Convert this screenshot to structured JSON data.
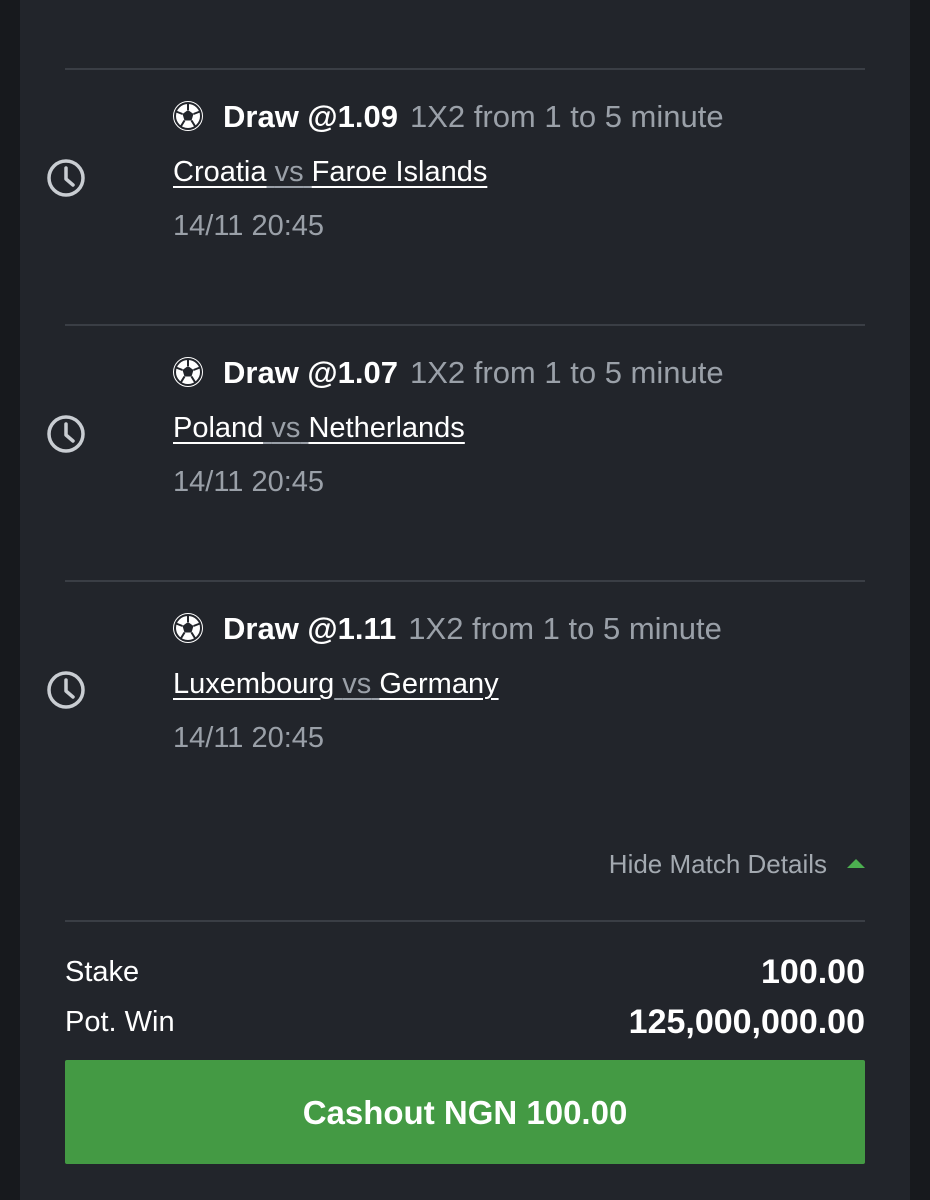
{
  "matches": [
    {
      "pick": "Draw @1.09",
      "market": "1X2 from 1 to 5 minute",
      "home": "Croatia",
      "vs": "vs",
      "away": "Faroe Islands",
      "datetime": "14/11 20:45",
      "icon": "soccer-ball-icon",
      "status_icon": "clock-icon"
    },
    {
      "pick": "Draw @1.07",
      "market": "1X2 from 1 to 5 minute",
      "home": "Poland",
      "vs": "vs",
      "away": "Netherlands",
      "datetime": "14/11 20:45",
      "icon": "soccer-ball-icon",
      "status_icon": "clock-icon"
    },
    {
      "pick": "Draw @1.11",
      "market": "1X2 from 1 to 5 minute",
      "home": "Luxembourg",
      "vs": "vs",
      "away": "Germany",
      "datetime": "14/11 20:45",
      "icon": "soccer-ball-icon",
      "status_icon": "clock-icon"
    }
  ],
  "details_toggle": {
    "label": "Hide Match Details",
    "icon": "caret-up-icon"
  },
  "summary": {
    "stake_label": "Stake",
    "stake_value": "100.00",
    "potwin_label": "Pot. Win",
    "potwin_value": "125,000,000.00"
  },
  "cashout": {
    "prefix": "Cashout",
    "amount": "NGN 100.00"
  },
  "colors": {
    "background": "#22252b",
    "muted_text": "#9aa0a8",
    "accent_green": "#449a44",
    "divider": "#3a3e45"
  }
}
